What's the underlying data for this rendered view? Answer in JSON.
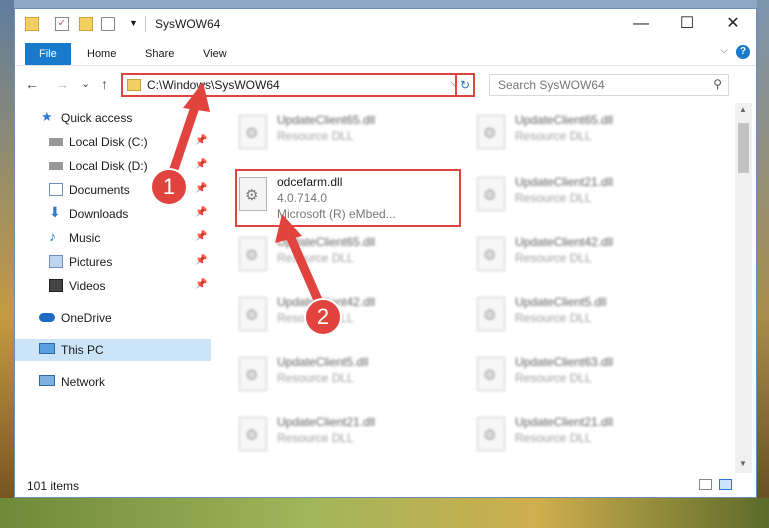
{
  "titlebar": {
    "title": "SysWOW64",
    "minimize": "—",
    "maximize": "☐",
    "close": "✕"
  },
  "ribbon": {
    "tabs": [
      "File",
      "Home",
      "Share",
      "View"
    ],
    "help": "?",
    "collapse": "⌵"
  },
  "nav": {
    "back": "←",
    "forward": "→",
    "recent": "⌄",
    "up": "↑",
    "path": "C:\\Windows\\SysWOW64",
    "dropdown": "⌵",
    "refresh": "↻",
    "search_placeholder": "Search SysWOW64",
    "search_icon": "⚲"
  },
  "sidebar": {
    "items": [
      {
        "label": "Quick access",
        "icon": "star-icon",
        "pinned": false
      },
      {
        "label": "Local Disk (C:)",
        "icon": "drive-icon",
        "pinned": true
      },
      {
        "label": "Local Disk (D:)",
        "icon": "drive-icon",
        "pinned": true
      },
      {
        "label": "Documents",
        "icon": "documents-icon",
        "pinned": true
      },
      {
        "label": "Downloads",
        "icon": "download-icon",
        "pinned": true
      },
      {
        "label": "Music",
        "icon": "music-icon",
        "pinned": true
      },
      {
        "label": "Pictures",
        "icon": "pictures-icon",
        "pinned": true
      },
      {
        "label": "Videos",
        "icon": "videos-icon",
        "pinned": true
      },
      {
        "label": "OneDrive",
        "icon": "cloud-icon",
        "pinned": false
      },
      {
        "label": "This PC",
        "icon": "computer-icon",
        "pinned": false,
        "selected": true
      },
      {
        "label": "Network",
        "icon": "network-icon",
        "pinned": false
      }
    ],
    "pin_glyph": "📌"
  },
  "files": {
    "left": [
      {
        "name": "UpdateClient65.dll",
        "type": "Resource DLL"
      },
      {
        "name": "odcefarm.dll",
        "version": "4.0.714.0",
        "company": "Microsoft (R) eMbed..."
      },
      {
        "name": "UpdateClient65.dll",
        "type": "Resource DLL"
      },
      {
        "name": "UpdateClient42.dll",
        "type": "Resource DLL"
      },
      {
        "name": "UpdateClient5.dll",
        "type": "Resource DLL"
      },
      {
        "name": "UpdateClient21.dll",
        "type": "Resource DLL"
      }
    ],
    "right": [
      {
        "name": "UpdateClient65.dll",
        "type": "Resource DLL"
      },
      {
        "name": "UpdateClient21.dll",
        "type": "Resource DLL"
      },
      {
        "name": "UpdateClient42.dll",
        "type": "Resource DLL"
      },
      {
        "name": "UpdateClient5.dll",
        "type": "Resource DLL"
      },
      {
        "name": "UpdateClient63.dll",
        "type": "Resource DLL"
      },
      {
        "name": "UpdateClient21.dll",
        "type": "Resource DLL"
      }
    ]
  },
  "callouts": {
    "one": "1",
    "two": "2"
  },
  "status": {
    "count": "101 items"
  },
  "colors": {
    "accent": "#1979ca",
    "highlight": "#e1443f"
  }
}
